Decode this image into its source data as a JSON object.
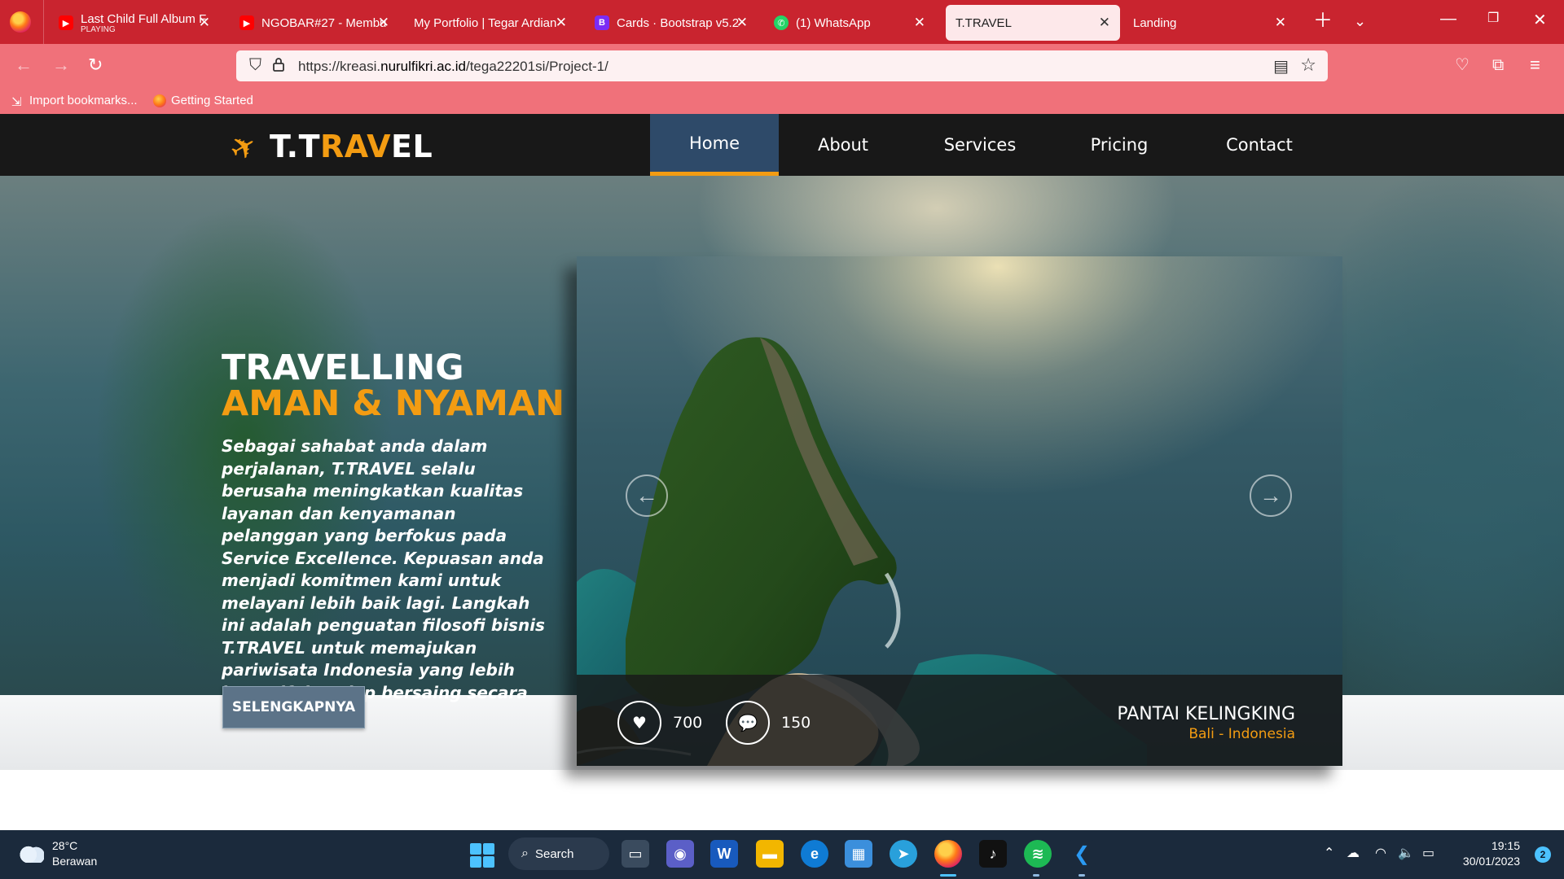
{
  "browser": {
    "tabs": [
      {
        "title": "Last Child Full Album F",
        "subtitle": "PLAYING",
        "favicon": "youtube-icon",
        "active": false
      },
      {
        "title": "NGOBAR#27 - Membu",
        "favicon": "youtube-icon",
        "active": false
      },
      {
        "title": "My Portfolio | Tegar Ardian",
        "favicon": "none",
        "active": false
      },
      {
        "title": "Cards · Bootstrap v5.2",
        "favicon": "bootstrap-icon",
        "active": false
      },
      {
        "title": "(1) WhatsApp",
        "favicon": "whatsapp-icon",
        "active": false
      },
      {
        "title": "T.TRAVEL",
        "favicon": "none",
        "active": true
      },
      {
        "title": "Landing",
        "favicon": "none",
        "active": false
      }
    ],
    "url_prefix": "https://kreasi.",
    "url_domain": "nurulfikri.ac.id",
    "url_path": "/tega22201si/Project-1/",
    "bookmarks": [
      "Import bookmarks...",
      "Getting Started"
    ],
    "colors": {
      "tabbar": "#c9242f",
      "toolbar": "#f0717a"
    }
  },
  "site": {
    "brand_prefix": "T.T",
    "brand_accent": "RAV",
    "brand_suffix": "EL",
    "nav": [
      "Home",
      "About",
      "Services",
      "Pricing",
      "Contact"
    ],
    "nav_active": "Home",
    "headline_line1": "TRAVELLING",
    "headline_line2": "AMAN & NYAMAN",
    "lead": "Sebagai sahabat anda dalam perjalanan, T.TRAVEL selalu berusaha meningkatkan kualitas layanan dan kenyamanan pelanggan yang berfokus pada Service Excellence. Kepuasan anda menjadi komitmen kami untuk melayani lebih baik lagi. Langkah ini adalah penguatan filosofi bisnis T.TRAVEL untuk memajukan pariwisata Indonesia yang lebih inovatif dan siap bersaing secara global.",
    "cta_label": "SELENGKAPNYA",
    "slide": {
      "likes": "700",
      "comments": "150",
      "place_name": "PANTAI KELINGKING",
      "place_location": "Bali - Indonesia"
    },
    "colors": {
      "accent": "#f39c12",
      "nav_bg": "#181818",
      "nav_active": "#2e4a69",
      "cta": "#5c7388"
    }
  },
  "taskbar": {
    "weather_temp": "28°C",
    "weather_desc": "Berawan",
    "search_label": "Search",
    "time": "19:15",
    "date": "30/01/2023",
    "notifications": "2"
  }
}
